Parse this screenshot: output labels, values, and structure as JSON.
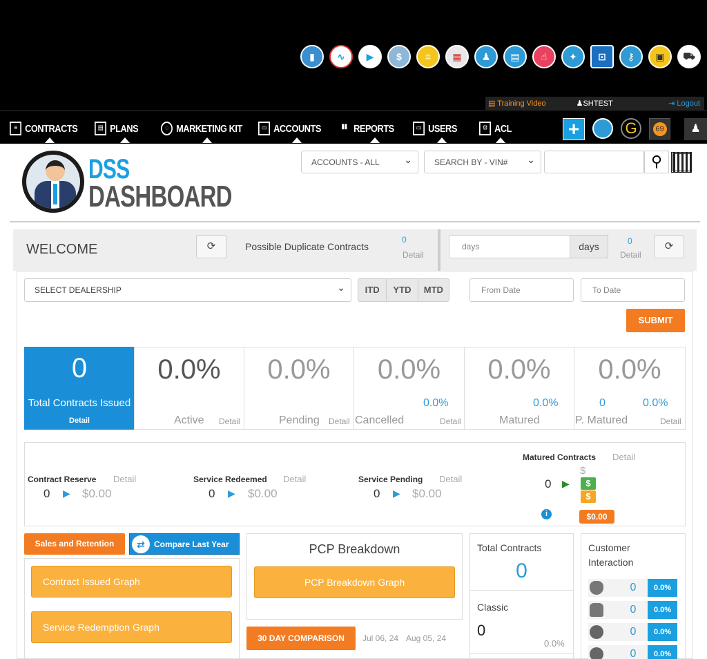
{
  "topbar": {
    "app_icons": [
      "chart-icon",
      "analytics-icon",
      "play-icon",
      "dollar-chat-icon",
      "message-icon",
      "calendar-icon",
      "people-icon",
      "documents-icon",
      "touch-icon",
      "walk-icon",
      "car-front-icon",
      "key-icon",
      "monitor-icon",
      "car-side-icon"
    ],
    "training_video": "Training Video",
    "username": "SHTEST",
    "logout": "Logout"
  },
  "nav": {
    "items": [
      "CONTRACTS",
      "PLANS",
      "MARKETING KIT",
      "ACCOUNTS",
      "REPORTS",
      "USERS",
      "ACL"
    ],
    "plus": "+",
    "g_label": "G",
    "badge_count": "69"
  },
  "logo": {
    "line1": "DSS",
    "line2": "DASHBOARD"
  },
  "search": {
    "accounts": "ACCOUNTS - ALL",
    "search_by": "SEARCH BY - VIN#",
    "value": ""
  },
  "welcome": {
    "title": "WELCOME",
    "duplicate_label": "Possible Duplicate Contracts",
    "duplicate_count": "0",
    "duplicate_detail": "Detail",
    "days_placeholder": "days",
    "days_addon": "days",
    "days_count": "0",
    "days_detail": "Detail"
  },
  "filters": {
    "dealership": "SELECT DEALERSHIP",
    "itd": "ITD",
    "ytd": "YTD",
    "mtd": "MTD",
    "from_date": "From Date",
    "to_date": "To Date",
    "submit": "SUBMIT"
  },
  "stats": {
    "total_value": "0",
    "total_label": "Total Contracts Issued",
    "total_detail": "Detail",
    "active_pct": "0.0%",
    "active_label": "Active",
    "active_detail": "Detail",
    "pending_pct": "0.0%",
    "pending_label": "Pending",
    "pending_detail": "Detail",
    "cancelled_pct": "0.0%",
    "cancelled_sub": "0.0%",
    "cancelled_label": "Cancelled",
    "cancelled_detail": "Detail",
    "matured_pct": "0.0%",
    "matured_sub": "0.0%",
    "matured_label": "Matured",
    "pmatured_pct": "0.0%",
    "pmatured_count": "0",
    "pmatured_sub": "0.0%",
    "pmatured_label": "P. Matured",
    "pmatured_detail": "Detail"
  },
  "financial": {
    "reserve_label": "Contract Reserve",
    "reserve_detail": "Detail",
    "reserve_count": "0",
    "reserve_amount": "$0.00",
    "redeemed_label": "Service Redeemed",
    "redeemed_detail": "Detail",
    "redeemed_count": "0",
    "redeemed_amount": "$0.00",
    "pending_label": "Service Pending",
    "pending_detail": "Detail",
    "pending_count": "0",
    "pending_amount": "$0.00",
    "matured_label": "Matured Contracts",
    "matured_detail": "Detail",
    "matured_count": "0",
    "dollar_sign": "$",
    "matured_amount": "$0.00"
  },
  "sales": {
    "tab_sales": "Sales and Retention",
    "tab_compare": "Compare Last Year",
    "btn_issued": "Contract Issued Graph",
    "btn_redemption": "Service Redemption Graph"
  },
  "pcp": {
    "title": "PCP Breakdown",
    "btn": "PCP Breakdown Graph",
    "comparison": "30 DAY COMPARISON",
    "date_from": "Jul 06, 24",
    "date_to": "Aug 05, 24"
  },
  "total_contracts": {
    "label": "Total Contracts",
    "value": "0",
    "classic_label": "Classic",
    "classic_value": "0",
    "classic_pct": "0.0%"
  },
  "customer_interaction": {
    "title_line1": "Customer",
    "title_line2": "Interaction",
    "rows": [
      {
        "icon": "apple-icon",
        "count": "0",
        "pct": "0.0%"
      },
      {
        "icon": "android-icon",
        "count": "0",
        "pct": "0.0%"
      },
      {
        "icon": "browser-icon",
        "count": "0",
        "pct": "0.0%"
      },
      {
        "icon": "chrome-icon",
        "count": "0",
        "pct": "0.0%"
      }
    ]
  }
}
